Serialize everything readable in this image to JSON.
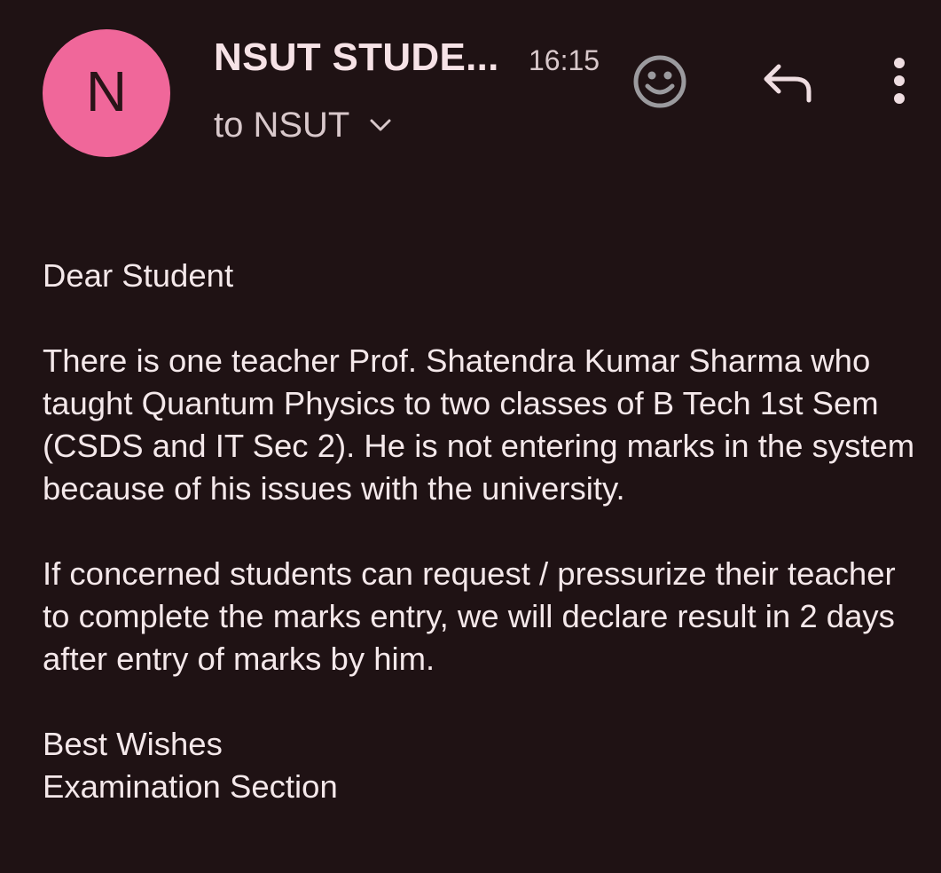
{
  "header": {
    "avatar_letter": "N",
    "sender": "NSUT STUDE...",
    "time": "16:15",
    "recipient": "to NSUT",
    "icons": {
      "expand": "chevron-down-icon",
      "react": "emoji-smile-icon",
      "reply": "reply-icon",
      "more": "more-vertical-icon"
    }
  },
  "message": {
    "greeting": "Dear Student",
    "paragraph1": "There is one teacher Prof. Shatendra Kumar Sharma who taught Quantum Physics to two classes of B Tech 1st Sem (CSDS and IT Sec 2). He is not entering marks in the system because of his issues with the university.",
    "paragraph2": "If concerned students can request / pressurize their teacher to complete the marks entry, we will declare result in 2 days after entry of marks by him.",
    "closing": "Best Wishes",
    "signature": "Examination Section"
  },
  "colors": {
    "background": "#1f1214",
    "avatar": "#f0679a",
    "text": "#f4e8ea",
    "secondary_text": "#d8c8cb",
    "emoji_icon": "#9b9a9e"
  }
}
